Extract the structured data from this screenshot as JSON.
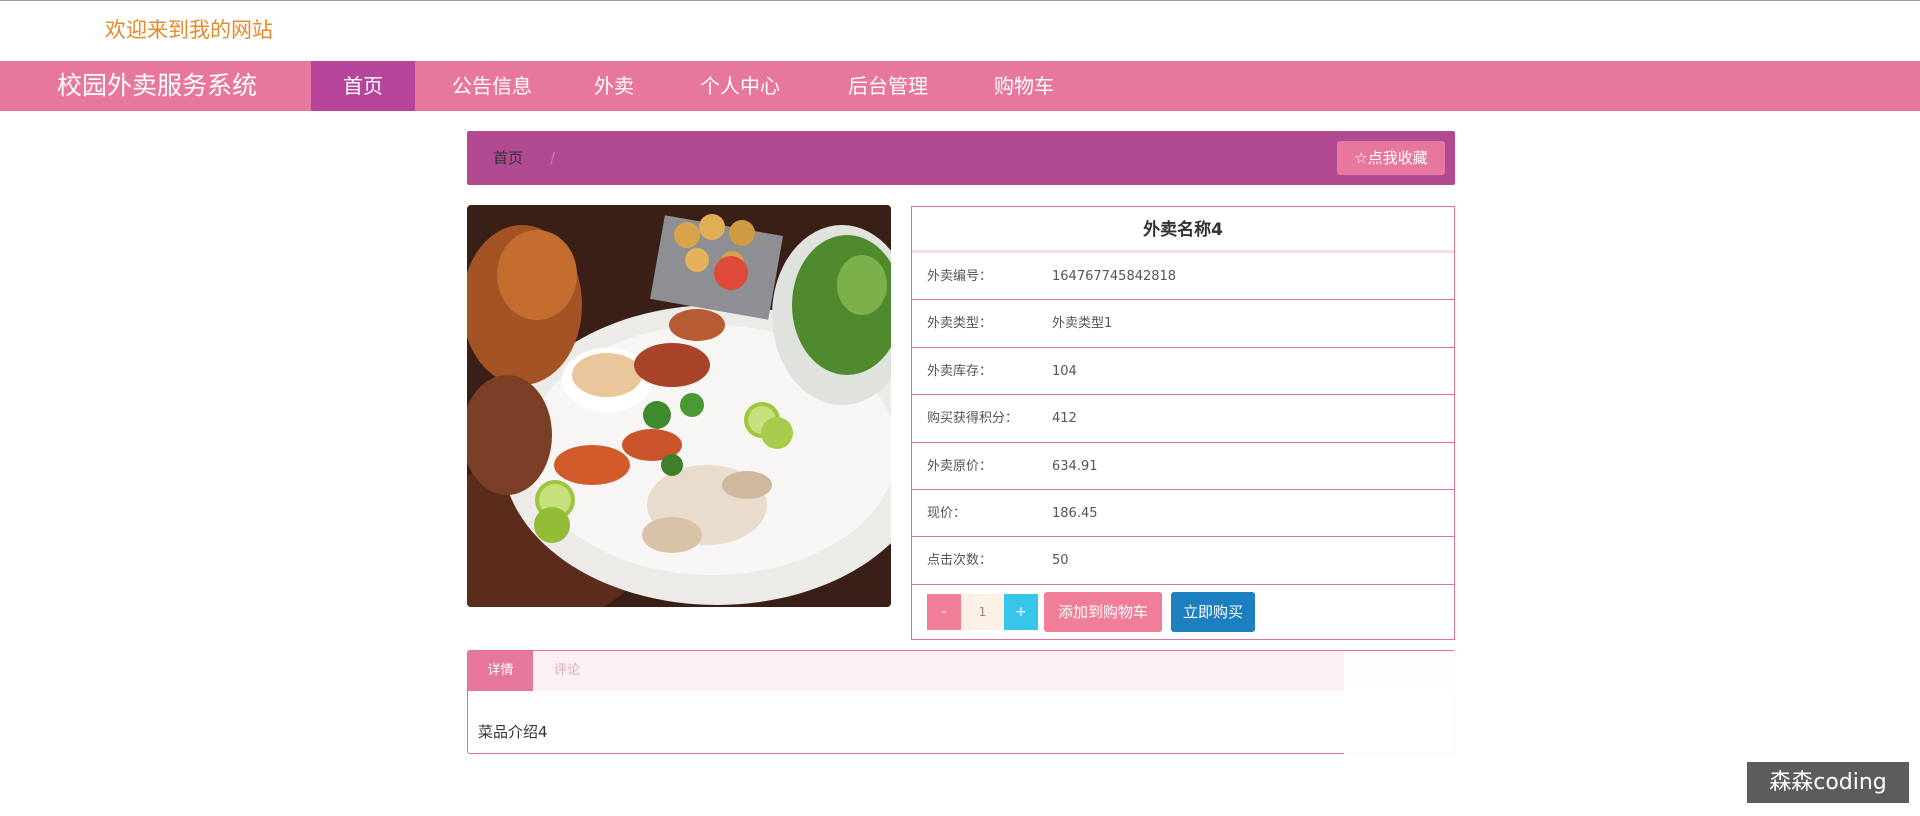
{
  "header": {
    "welcome": "欢迎来到我的网站"
  },
  "nav": {
    "brand": "校园外卖服务系统",
    "items": [
      "首页",
      "公告信息",
      "外卖",
      "个人中心",
      "后台管理",
      "购物车"
    ],
    "active_index": 0
  },
  "breadcrumb": {
    "home": "首页",
    "separator": "/"
  },
  "favorite_label": "点我收藏",
  "product": {
    "title": "外卖名称4",
    "rows": [
      {
        "label": "外卖编号：",
        "value": "164767745842818"
      },
      {
        "label": "外卖类型：",
        "value": "外卖类型1"
      },
      {
        "label": "外卖库存：",
        "value": "104"
      },
      {
        "label": "购买获得积分：",
        "value": "412"
      },
      {
        "label": "外卖原价：",
        "value": "634.91"
      },
      {
        "label": "现价：",
        "value": "186.45"
      },
      {
        "label": "点击次数：",
        "value": "50"
      }
    ]
  },
  "quantity": {
    "minus": "-",
    "value": "1",
    "plus": "+"
  },
  "actions": {
    "add_to_cart": "添加到购物车",
    "buy_now": "立即购买"
  },
  "tabs": {
    "details": "详情",
    "comments": "评论",
    "content": "菜品介绍4"
  },
  "watermark": "森森coding",
  "colors": {
    "nav": "#e7779c",
    "nav_active": "#b6449a",
    "breadcrumb_bar": "#b24a92",
    "buy_button": "#1b7fc0",
    "plus_button": "#38c5ea"
  }
}
